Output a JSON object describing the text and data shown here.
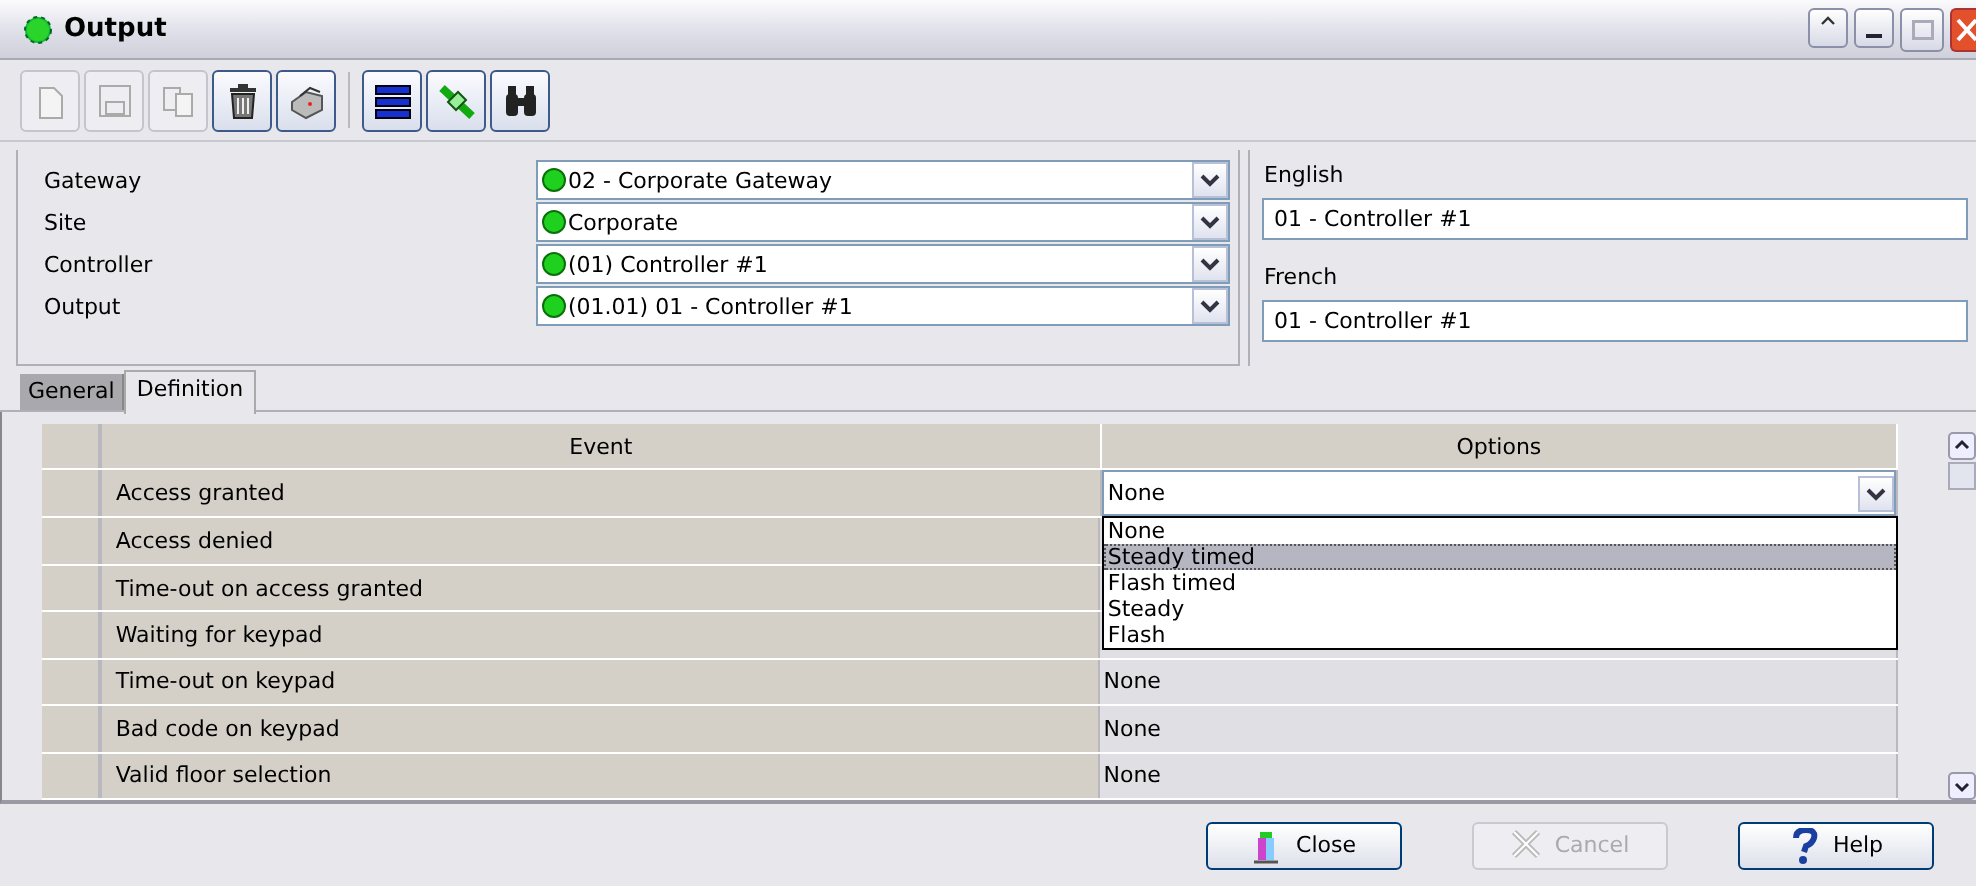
{
  "window": {
    "title": "Output"
  },
  "toolbar": {
    "groups": [
      [
        {
          "disabled": true
        },
        {
          "disabled": true
        },
        {
          "disabled": true
        },
        {
          "disabled": false
        },
        {
          "disabled": false
        }
      ],
      [
        {
          "disabled": false
        },
        {
          "disabled": false
        },
        {
          "disabled": false
        }
      ]
    ]
  },
  "form": {
    "fields": [
      {
        "label": "Gateway",
        "value": "02 - Corporate Gateway"
      },
      {
        "label": "Site",
        "value": "Corporate"
      },
      {
        "label": "Controller",
        "value": "(01) Controller #1"
      },
      {
        "label": "Output",
        "value": "(01.01) 01 - Controller #1"
      }
    ]
  },
  "names": [
    {
      "label": "English",
      "value": "01 - Controller #1"
    },
    {
      "label": "French",
      "value": "01 - Controller #1"
    }
  ],
  "tabs": [
    {
      "label": "General",
      "selected": false
    },
    {
      "label": "Definition",
      "selected": true
    }
  ],
  "table": {
    "columns": [
      "Event",
      "Options"
    ],
    "rows": [
      {
        "event": "Access granted",
        "option": "None",
        "editing": true
      },
      {
        "event": "Access denied"
      },
      {
        "event": "Time-out on access granted"
      },
      {
        "event": "Waiting for keypad"
      },
      {
        "event": "Time-out on keypad",
        "option": "None"
      },
      {
        "event": "Bad code on keypad",
        "option": "None"
      },
      {
        "event": "Valid floor selection",
        "option": "None"
      }
    ],
    "dropdown": [
      {
        "label": "None",
        "selected": false
      },
      {
        "label": "Steady timed",
        "selected": true
      },
      {
        "label": "Flash timed",
        "selected": false
      },
      {
        "label": "Steady",
        "selected": false
      },
      {
        "label": "Flash",
        "selected": false
      }
    ]
  },
  "buttons": [
    {
      "label": "Close",
      "kind": "close",
      "disabled": false
    },
    {
      "label": "Cancel",
      "kind": "cancel",
      "disabled": true
    },
    {
      "label": "Help",
      "kind": "help",
      "disabled": false
    }
  ]
}
